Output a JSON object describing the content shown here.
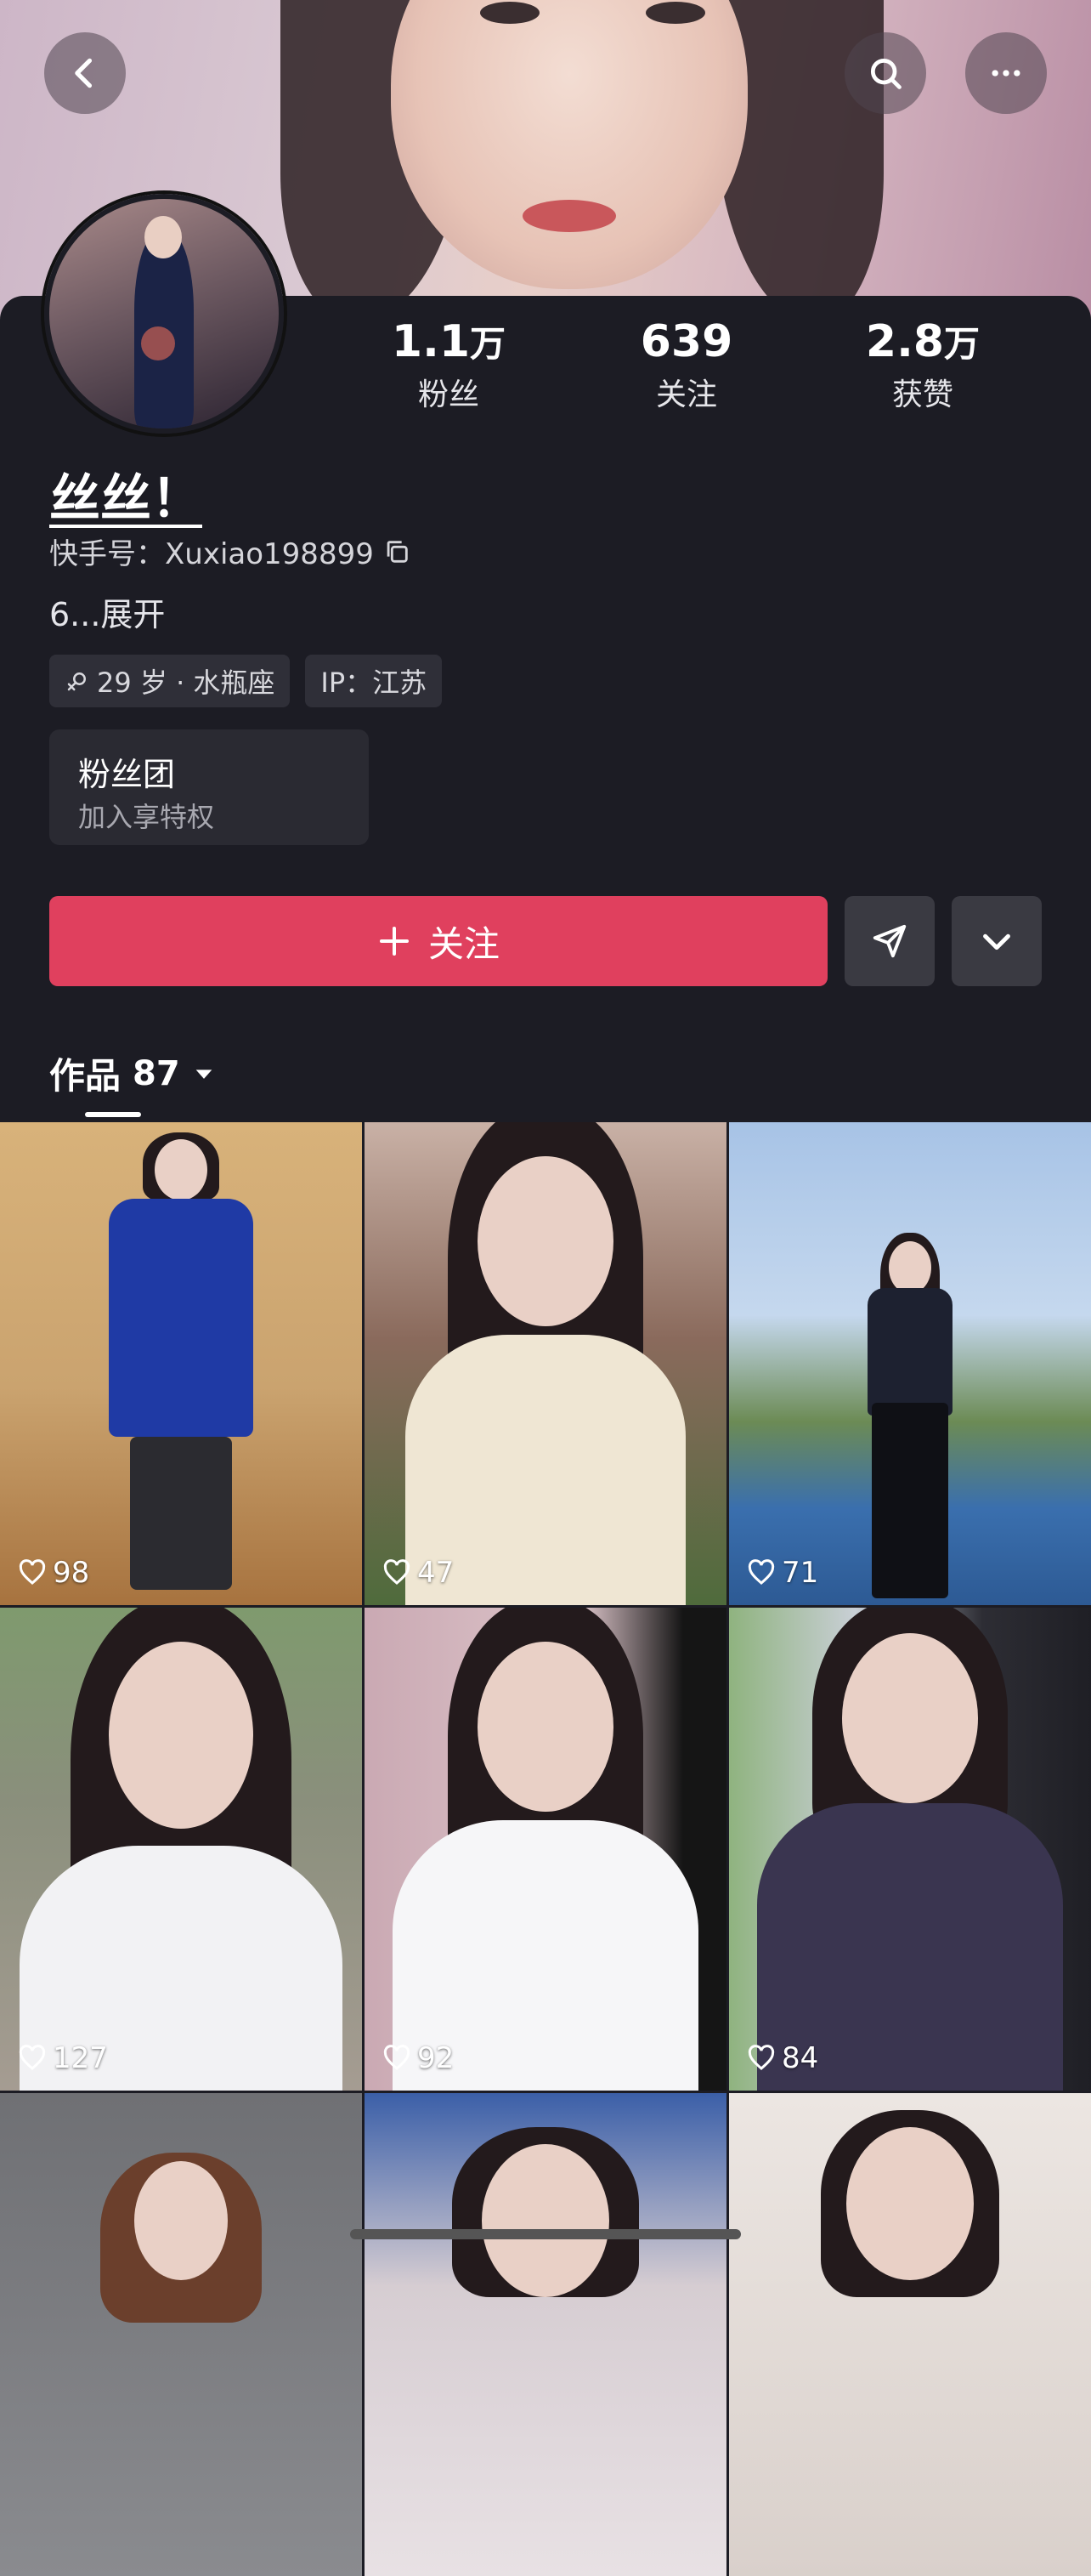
{
  "header": {
    "back_icon": "chevron-left-icon",
    "search_icon": "search-icon",
    "more_icon": "more-icon"
  },
  "profile": {
    "name": "丝丝！",
    "account": "快手号：Xuxiao198899",
    "bio_text": "6...",
    "bio_more": "展开",
    "tags": [
      "29 岁 · 水瓶座",
      "IP：江苏"
    ],
    "stats": [
      {
        "num": "1.1",
        "unit": "万",
        "label": "粉丝"
      },
      {
        "num": "639",
        "unit": "",
        "label": "关注"
      },
      {
        "num": "2.8",
        "unit": "万",
        "label": "获赞"
      }
    ]
  },
  "fanclub": {
    "title": "粉丝团",
    "subtitle": "加入享特权"
  },
  "actions": {
    "follow_label": "关注"
  },
  "works": {
    "tab_label": "作品",
    "count": "87"
  },
  "grid": [
    {
      "likes": "98"
    },
    {
      "likes": "47"
    },
    {
      "likes": "71"
    },
    {
      "likes": "127"
    },
    {
      "likes": "92"
    },
    {
      "likes": "84"
    },
    {
      "likes": ""
    },
    {
      "likes": ""
    },
    {
      "likes": ""
    }
  ],
  "colors": {
    "accent": "#e0405e",
    "background": "#1c1c24"
  }
}
